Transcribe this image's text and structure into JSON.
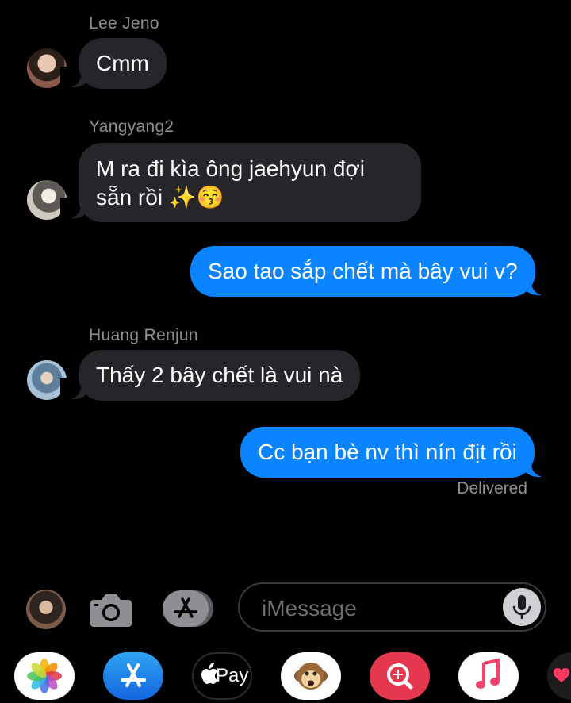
{
  "messages": [
    {
      "sender": "Lee Jeno",
      "text": "Cmm",
      "direction": "incoming"
    },
    {
      "sender": "Yangyang2",
      "text": "M ra đi kìa ông jaehyun đợi sẵn rồi ✨😚",
      "direction": "incoming"
    },
    {
      "text": "Sao tao sắp chết mà bây vui v?",
      "direction": "outgoing"
    },
    {
      "sender": "Huang Renjun",
      "text": "Thấy 2 bây chết là vui nà",
      "direction": "incoming"
    },
    {
      "text": "Cc bạn bè nv thì nín địt rồi",
      "direction": "outgoing"
    }
  ],
  "status": "Delivered",
  "composer": {
    "placeholder": "iMessage"
  },
  "app_drawer": {
    "icons": [
      "photos-icon",
      "app-store-icon",
      "apple-pay-icon",
      "animoji-icon",
      "search-images-icon",
      "music-icon",
      "heart-icon"
    ],
    "apple_pay_label": "Pay"
  },
  "colors": {
    "outgoing_bubble": "#0a84ff",
    "incoming_bubble": "#26252a",
    "background": "#000000"
  }
}
